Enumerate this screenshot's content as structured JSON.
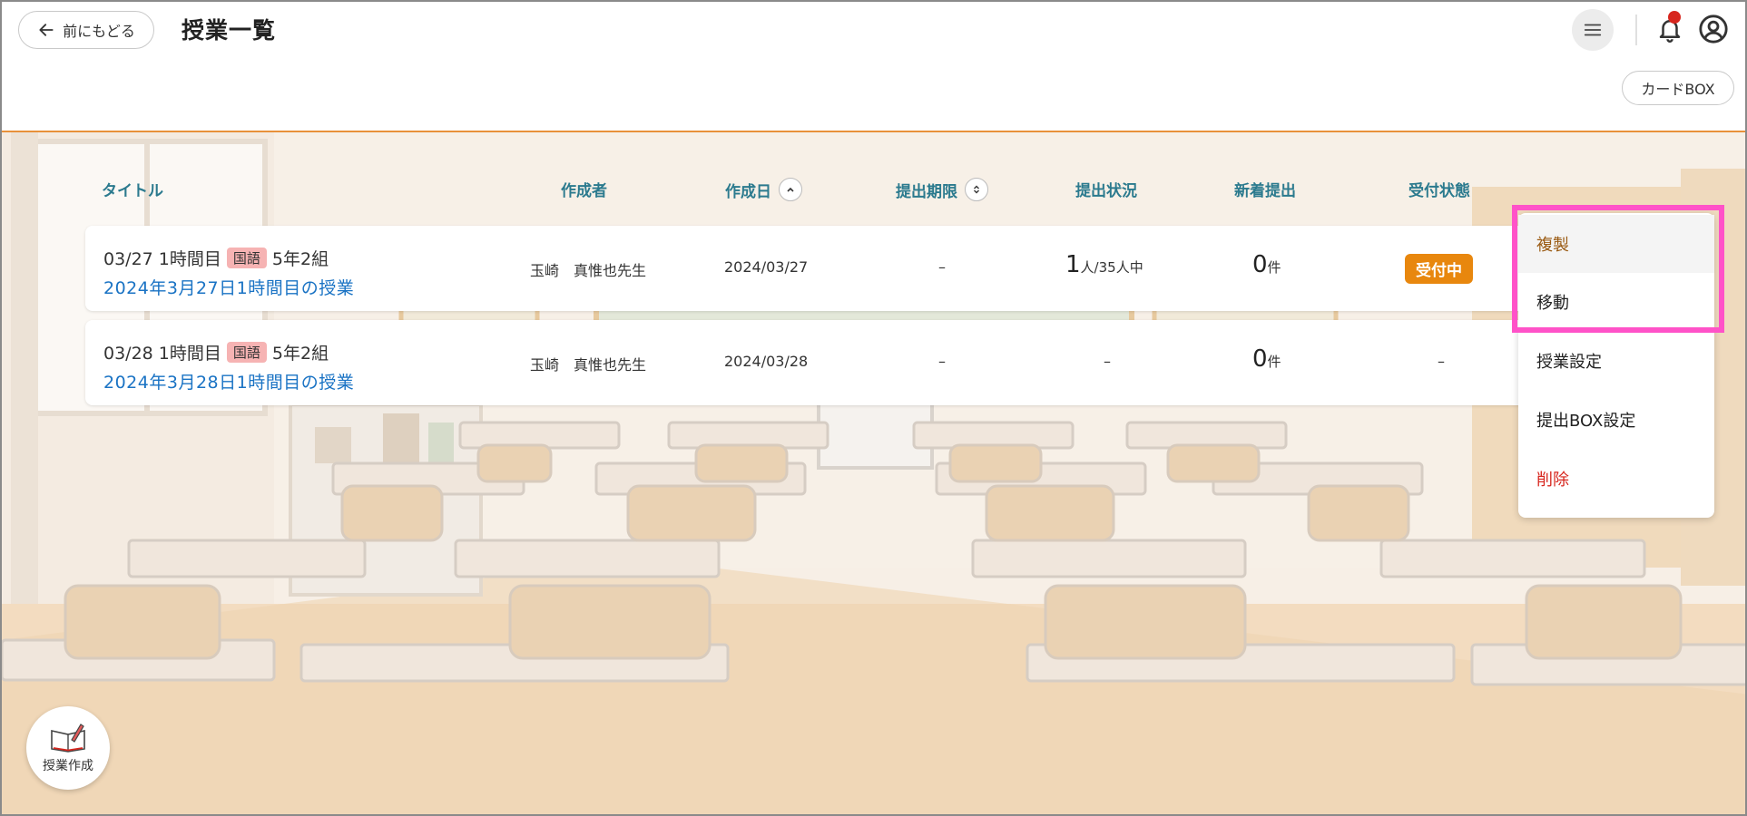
{
  "header": {
    "back_label": "前にもどる",
    "title": "授業一覧",
    "cardbox_label": "カードBOX"
  },
  "icons": {
    "back": "arrow-left-icon",
    "menu": "hamburger-menu-icon",
    "notifications": "bell-icon",
    "account": "user-circle-icon",
    "create": "book-pencil-icon"
  },
  "colors": {
    "accent_orange": "#e8913a",
    "header_text": "#2b7a8e",
    "link_blue": "#1a73c4",
    "status_orange": "#e8870e",
    "delete_red": "#d7261e",
    "copy_brown": "#9a5a12",
    "highlight_pink": "#ff52c8",
    "subject_badge": "#f6b3b3"
  },
  "table": {
    "columns": {
      "title": "タイトル",
      "author": "作成者",
      "created": "作成日",
      "deadline": "提出期限",
      "submission_status": "提出状況",
      "new_submissions": "新着提出",
      "accept_status": "受付状態"
    },
    "rows": [
      {
        "date_period": "03/27 1時間目",
        "subject": "国語",
        "class": "5年2組",
        "lesson_title": "2024年3月27日1時間目の授業",
        "author": "玉崎　真惟也先生",
        "created": "2024/03/27",
        "deadline": "–",
        "submitted_count": "1",
        "submitted_suffix": "人/35人中",
        "new_count": "0",
        "new_suffix": "件",
        "accept_status": "受付中"
      },
      {
        "date_period": "03/28 1時間目",
        "subject": "国語",
        "class": "5年2組",
        "lesson_title": "2024年3月28日1時間目の授業",
        "author": "玉崎　真惟也先生",
        "created": "2024/03/28",
        "deadline": "–",
        "submitted": "–",
        "new_count": "0",
        "new_suffix": "件",
        "accept_status": "–"
      }
    ]
  },
  "context_menu": {
    "items": [
      {
        "label": "複製"
      },
      {
        "label": "移動"
      },
      {
        "label": "授業設定"
      },
      {
        "label": "提出BOX設定"
      },
      {
        "label": "削除"
      }
    ]
  },
  "fab": {
    "label": "授業作成"
  }
}
